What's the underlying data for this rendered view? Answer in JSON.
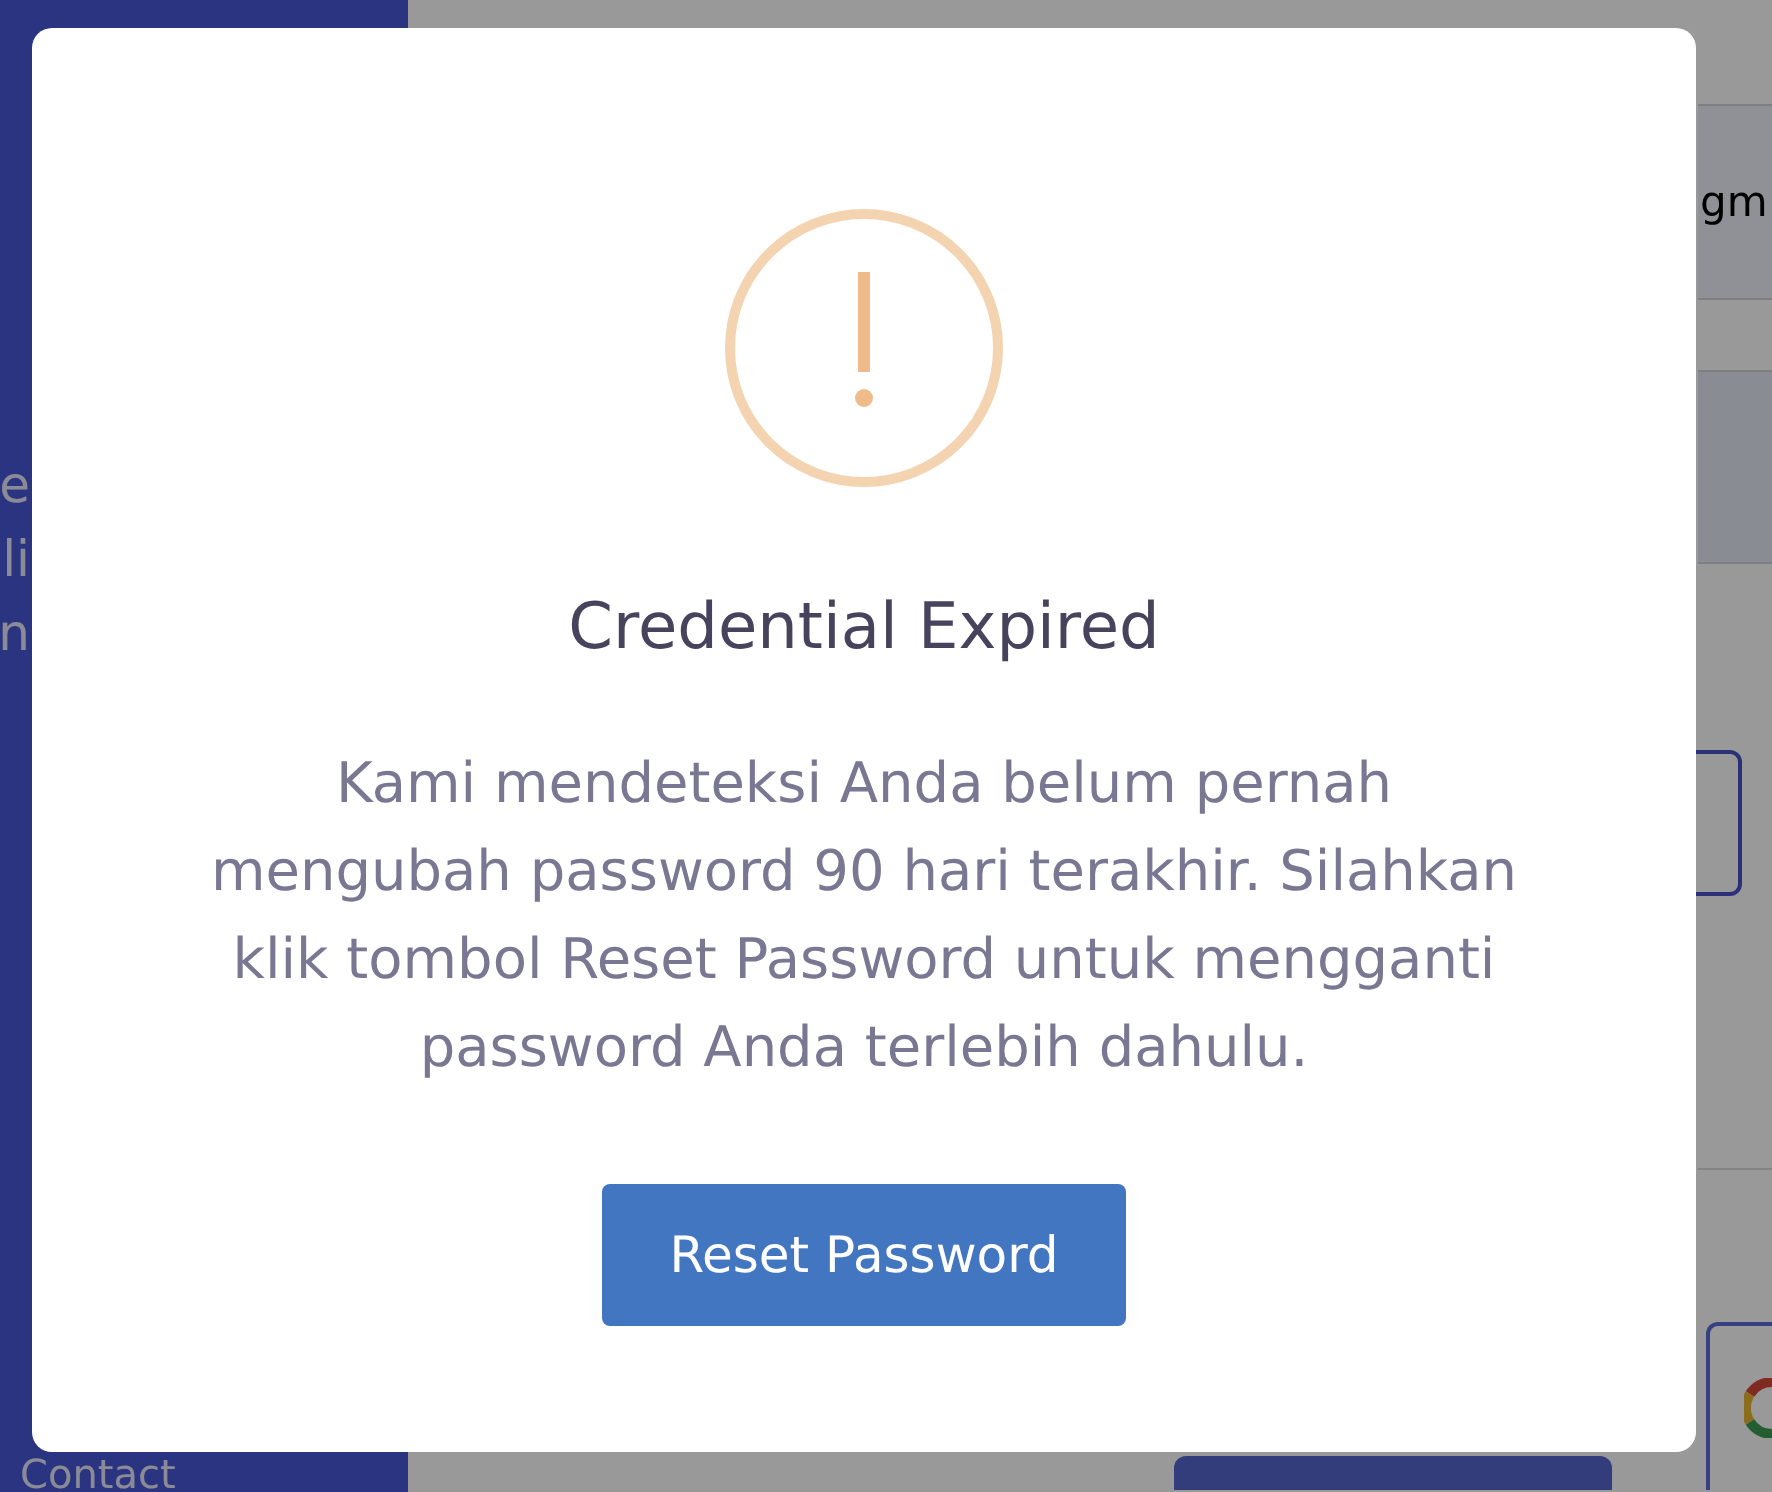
{
  "background": {
    "sidebar": {
      "text_lines": [
        "e",
        "li",
        "n"
      ],
      "footer_link": "Contact"
    },
    "form": {
      "email_field": {
        "value": "gm"
      }
    }
  },
  "dialog": {
    "title": "Credential Expired",
    "message": "Kami mendeteksi Anda belum pernah mengubah password 90 hari terakhir. Silahkan klik tombol Reset Password untuk mengganti password Anda terlebih dahulu.",
    "button": "Reset Password"
  }
}
